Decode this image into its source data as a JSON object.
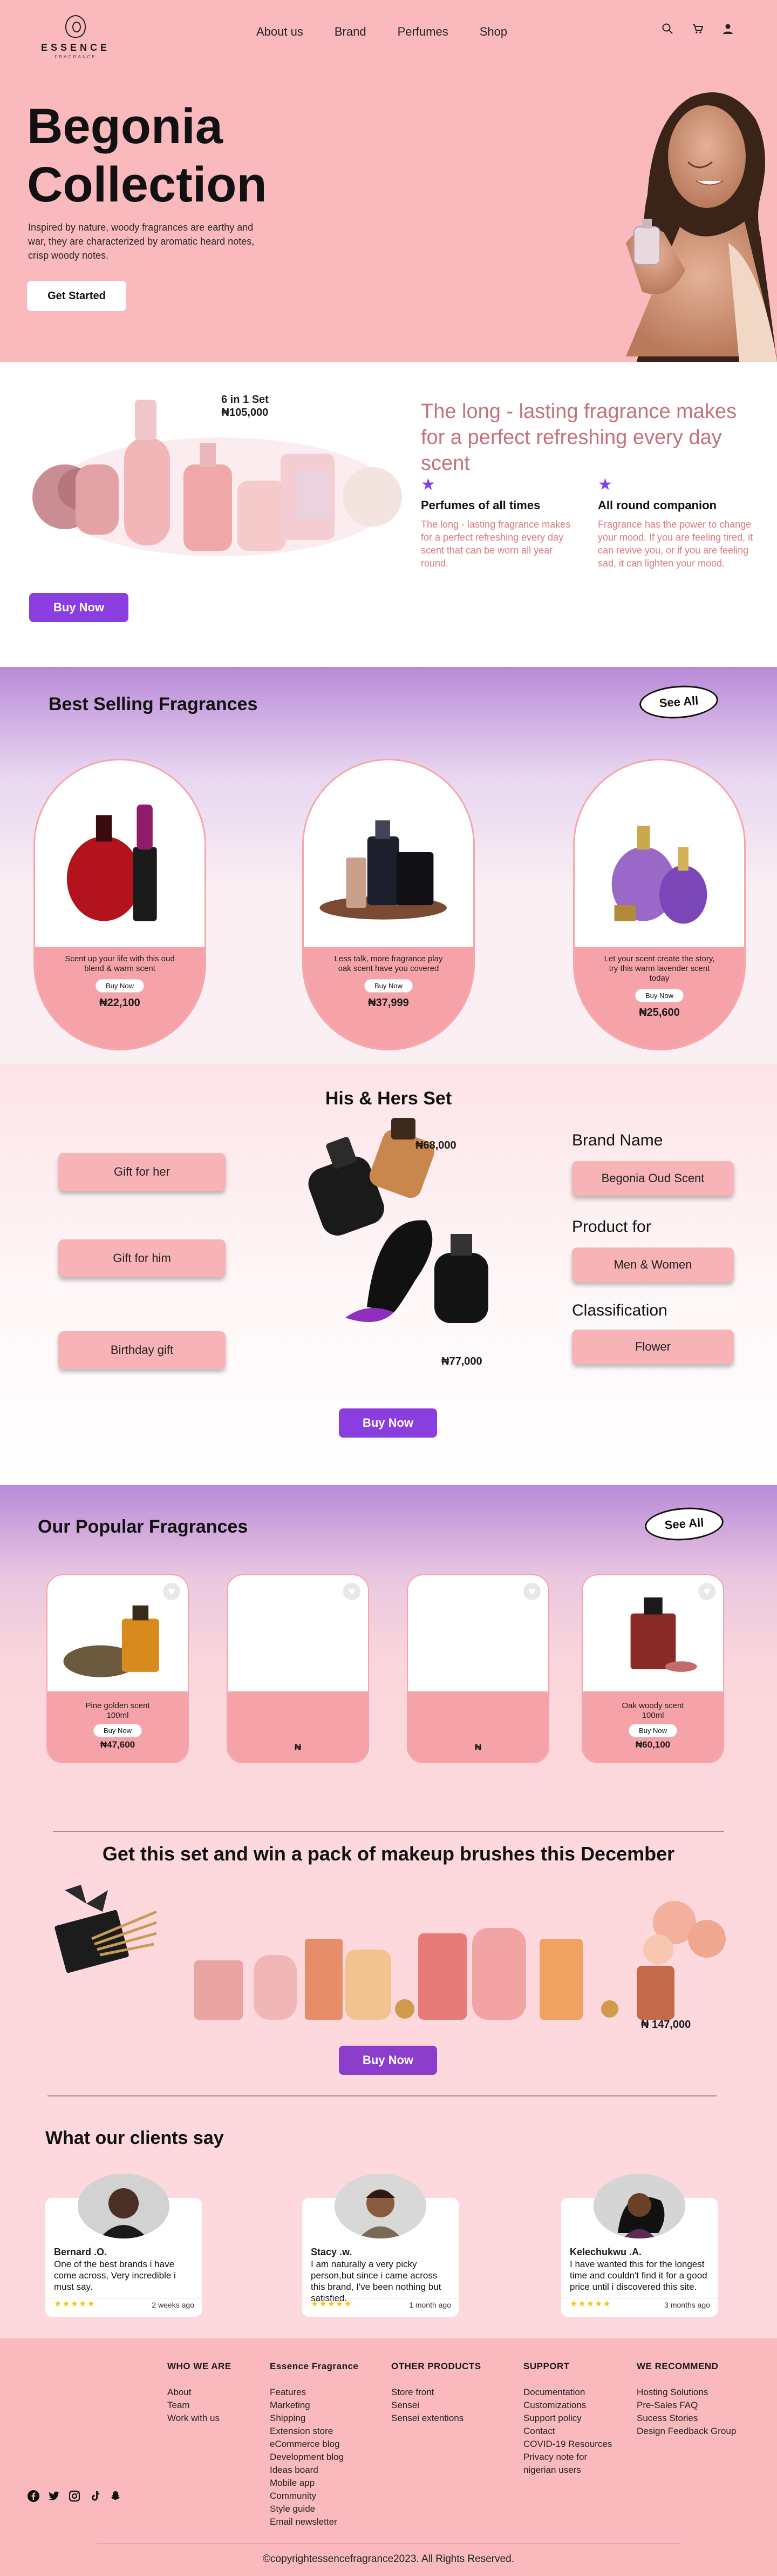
{
  "header": {
    "logo_text": "ESSENCE",
    "logo_sub": "FRAGRANCE",
    "nav": [
      "About us",
      "Brand",
      "Perfumes",
      "Shop"
    ],
    "icons": [
      "search-icon",
      "cart-icon",
      "user-icon"
    ]
  },
  "hero": {
    "title_line1": "Begonia",
    "title_line2": "Collection",
    "description": "Inspired by nature, woody fragrances are earthy and war, they are characterized by aromatic heard notes, crisp woody notes.",
    "cta": "Get Started"
  },
  "offer": {
    "set_label": "6 in 1 Set",
    "set_price": "₦105,000",
    "heading": "The long - lasting fragrance makes for a perfect refreshing every day scent",
    "features": [
      {
        "title": "Perfumes of all times",
        "text": "The long - lasting fragrance makes for a perfect refreshing every day scent that can be worn all year round."
      },
      {
        "title": "All round companion",
        "text": "Fragrance has the power to change your mood. If you are feeling tired, it can revive you, or if you are feeling sad, it can lighten your mood."
      }
    ],
    "cta": "Buy Now"
  },
  "best": {
    "title": "Best Selling Fragrances",
    "see_all": "See All",
    "items": [
      {
        "desc": "Scent up your life with this oud blend & warm scent",
        "button": "Buy Now",
        "price": "₦22,100"
      },
      {
        "desc": "Less talk, more fragrance play oak scent have you covered",
        "button": "Buy Now",
        "price": "₦37,999"
      },
      {
        "desc": "Let your scent create the story, try this warm lavender scent today",
        "button": "Buy Now",
        "price": "₦25,600"
      }
    ]
  },
  "hishers": {
    "title": "His & Hers Set",
    "gift_buttons": [
      "Gift for her",
      "Gift for him",
      "Birthday gift"
    ],
    "price_top": "₦68,000",
    "price_bottom": "₦77,000",
    "brand_label": "Brand Name",
    "brand_value": "Begonia Oud Scent",
    "product_label": "Product for",
    "product_value": "Men & Women",
    "class_label": "Classification",
    "class_value": "Flower",
    "cta": "Buy Now"
  },
  "popular": {
    "title": "Our Popular Fragrances",
    "see_all": "See All",
    "items": [
      {
        "desc_line1": "Pine golden scent",
        "desc_line2": "100ml",
        "button": "Buy Now",
        "price": "₦47,600"
      },
      {
        "desc_line1": "",
        "desc_line2": "",
        "button": "",
        "price": "₦"
      },
      {
        "desc_line1": "",
        "desc_line2": "",
        "button": "",
        "price": "₦"
      },
      {
        "desc_line1": "Oak woody scent",
        "desc_line2": "100ml",
        "button": "Buy Now",
        "price": "₦60,100"
      }
    ]
  },
  "promo": {
    "title": "Get this set and win a  pack of makeup brushes this December",
    "price": "₦ 147,000",
    "cta": "Buy Now"
  },
  "testimonials": {
    "title": "What our clients say",
    "items": [
      {
        "name": "Bernard .O.",
        "text": "One of the best brands i have come across, Very incredible i must say.",
        "stars": "★★★★★",
        "time": "2 weeks ago"
      },
      {
        "name": "Stacy .w.",
        "text": "I am naturally a very picky person,but since i came across this brand, I've been nothing but satisfied.",
        "stars": "★★★★★",
        "time": "1 month ago"
      },
      {
        "name": "Kelechukwu .A.",
        "text": "I have wanted this for the longest time and couldn't find it for a good price until i discovered this site.",
        "stars": "★★★★★",
        "time": "3 months ago"
      }
    ]
  },
  "footer": {
    "columns": [
      {
        "title": "WHO WE ARE",
        "links": [
          "About",
          "Team",
          "Work with us"
        ]
      },
      {
        "title": "Essence Fragrance",
        "links": [
          "Features",
          "Marketing",
          "Shipping",
          "Extension store",
          "eCommerce blog",
          "Development blog",
          "Ideas board",
          "Mobile app",
          "Community",
          "Style guide",
          "Email newsletter"
        ]
      },
      {
        "title": "OTHER PRODUCTS",
        "links": [
          "Store front",
          "Sensei",
          "Sensei extentions"
        ]
      },
      {
        "title": "SUPPORT",
        "links": [
          "Documentation",
          "Customizations",
          "Support policy",
          "Contact",
          "COVID-19 Resources",
          "Privacy note for",
          "nigerian users"
        ]
      },
      {
        "title": "WE RECOMMEND",
        "links": [
          "Hosting Solutions",
          "Pre-Sales FAQ",
          "Sucess Stories",
          "Design Feedback Group"
        ]
      }
    ],
    "socials": [
      "facebook-icon",
      "twitter-icon",
      "instagram-icon",
      "tiktok-icon",
      "snapchat-icon"
    ],
    "copyright": "copyrightessencefragrance2023. All Rights Reserved."
  },
  "colors": {
    "header_pink": "#f9b9bd",
    "accent_purple": "#8b3ee0",
    "card_pink": "#f5a3a8",
    "heading_rose": "#c4727a"
  }
}
